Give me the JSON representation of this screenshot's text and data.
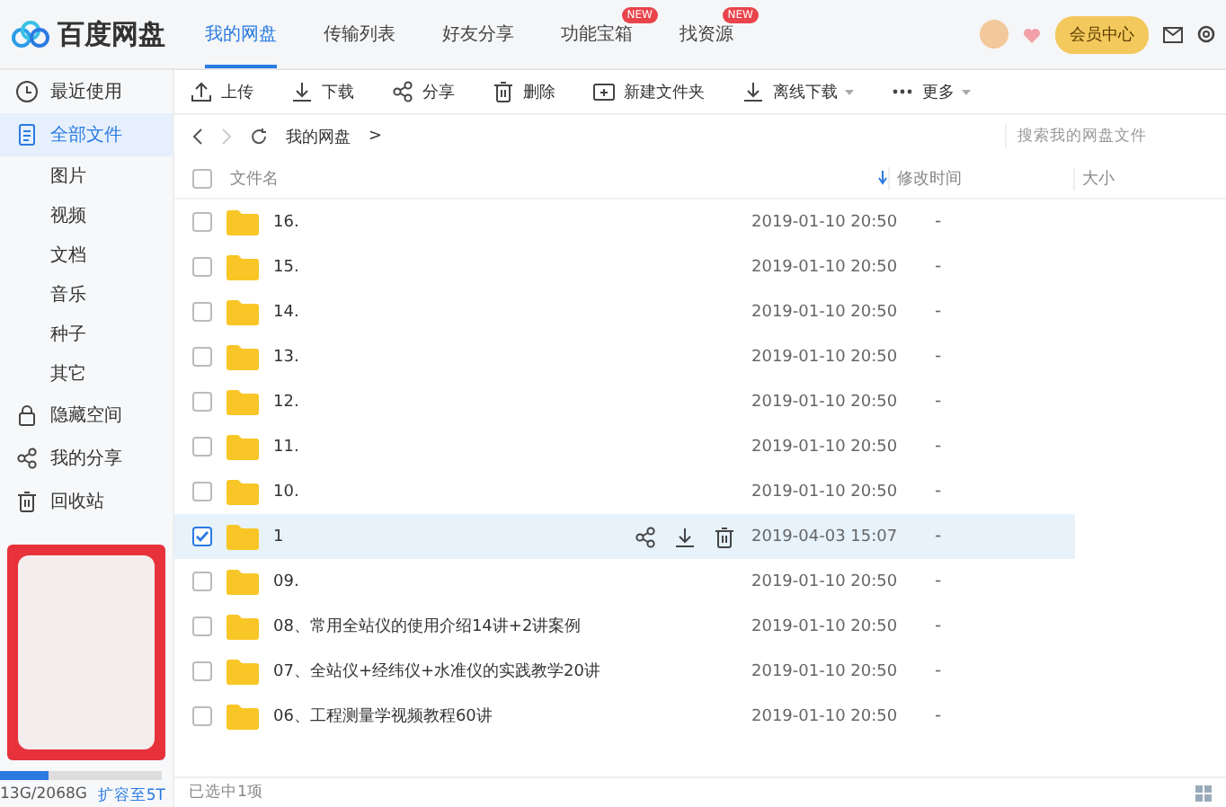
{
  "app": {
    "logo": "百度网盘"
  },
  "nav_tabs": [
    {
      "label": "我的网盘",
      "selected": true
    },
    {
      "label": "传输列表",
      "selected": false
    },
    {
      "label": "好友分享",
      "selected": false
    },
    {
      "label": "功能宝箱",
      "selected": false,
      "badge": "NEW"
    },
    {
      "label": "找资源",
      "selected": false,
      "badge": "NEW"
    }
  ],
  "vip_button": "会员中心",
  "sidebar": {
    "items": [
      {
        "label": "最近使用",
        "selected": false
      },
      {
        "label": "全部文件",
        "selected": true,
        "children": [
          {
            "label": "图片",
            "selected": false
          },
          {
            "label": "视频",
            "selected": false
          },
          {
            "label": "文档",
            "selected": false
          },
          {
            "label": "音乐",
            "selected": false
          },
          {
            "label": "种子",
            "selected": false
          },
          {
            "label": "其它",
            "selected": false
          }
        ]
      },
      {
        "label": "隐藏空间",
        "selected": false
      },
      {
        "label": "我的分享",
        "selected": false
      },
      {
        "label": "回收站",
        "selected": false
      }
    ],
    "storage": {
      "level": 0.3,
      "text": "13G/2068G",
      "link": "扩容至5T"
    }
  },
  "toolbar": [
    {
      "label": "上传",
      "dropdown": false
    },
    {
      "label": "下载",
      "dropdown": false
    },
    {
      "label": "分享",
      "dropdown": false
    },
    {
      "label": "删除",
      "dropdown": false
    },
    {
      "label": "新建文件夹",
      "dropdown": false
    },
    {
      "label": "离线下载",
      "dropdown": true
    },
    {
      "label": "更多",
      "dropdown": true
    }
  ],
  "breadcrumb": [
    "我的网盘",
    ">"
  ],
  "search": {
    "placeholder": "搜索我的网盘文件"
  },
  "table": {
    "columns": [
      "文件名",
      "修改时间",
      "大小"
    ],
    "select_all": false,
    "rows": [
      {
        "name": "16.",
        "modified": "2019-01-10 20:50",
        "size": "-",
        "selected": false
      },
      {
        "name": "15.",
        "modified": "2019-01-10 20:50",
        "size": "-",
        "selected": false
      },
      {
        "name": "14.",
        "modified": "2019-01-10 20:50",
        "size": "-",
        "selected": false
      },
      {
        "name": "13.",
        "modified": "2019-01-10 20:50",
        "size": "-",
        "selected": false
      },
      {
        "name": "12.",
        "modified": "2019-01-10 20:50",
        "size": "-",
        "selected": false
      },
      {
        "name": "11.",
        "modified": "2019-01-10 20:50",
        "size": "-",
        "selected": false
      },
      {
        "name": "10.",
        "modified": "2019-01-10 20:50",
        "size": "-",
        "selected": false
      },
      {
        "name": "1",
        "modified": "2019-04-03 15:07",
        "size": "-",
        "selected": true
      },
      {
        "name": "09.",
        "modified": "2019-01-10 20:50",
        "size": "-",
        "selected": false
      },
      {
        "name": "08、常用全站仪的使用介绍14讲+2讲案例",
        "modified": "2019-01-10 20:50",
        "size": "-",
        "selected": false
      },
      {
        "name": "07、全站仪+经纬仪+水准仪的实践教学20讲",
        "modified": "2019-01-10 20:50",
        "size": "-",
        "selected": false
      },
      {
        "name": "06、工程测量学视频教程60讲",
        "modified": "2019-01-10 20:50",
        "size": "-",
        "selected": false
      }
    ]
  },
  "status_bar": {
    "text": "已选中1项"
  }
}
